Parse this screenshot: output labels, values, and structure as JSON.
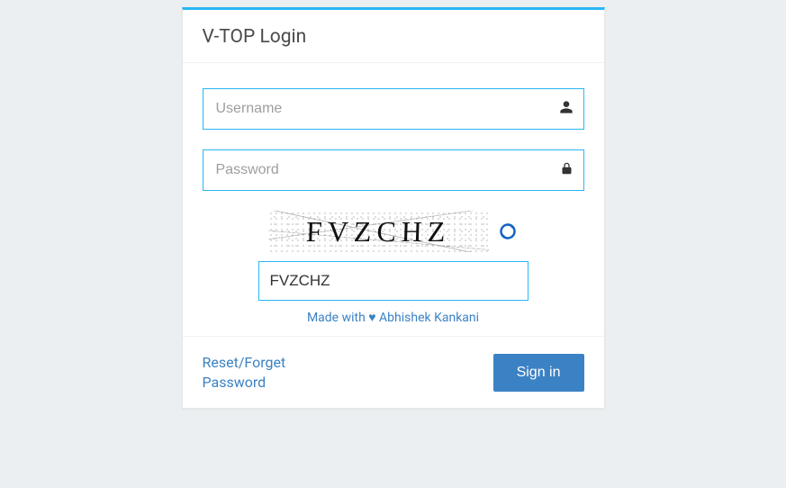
{
  "header": {
    "title": "V-TOP Login"
  },
  "form": {
    "username": {
      "placeholder": "Username",
      "value": ""
    },
    "password": {
      "placeholder": "Password",
      "value": ""
    },
    "captcha": {
      "image_text": "FVZCHZ",
      "input_value": "FVZCHZ"
    }
  },
  "credit": {
    "text": "Made with ♥ Abhishek Kankani"
  },
  "footer": {
    "forgot_label": "Reset/Forget Password",
    "signin_label": "Sign in"
  }
}
